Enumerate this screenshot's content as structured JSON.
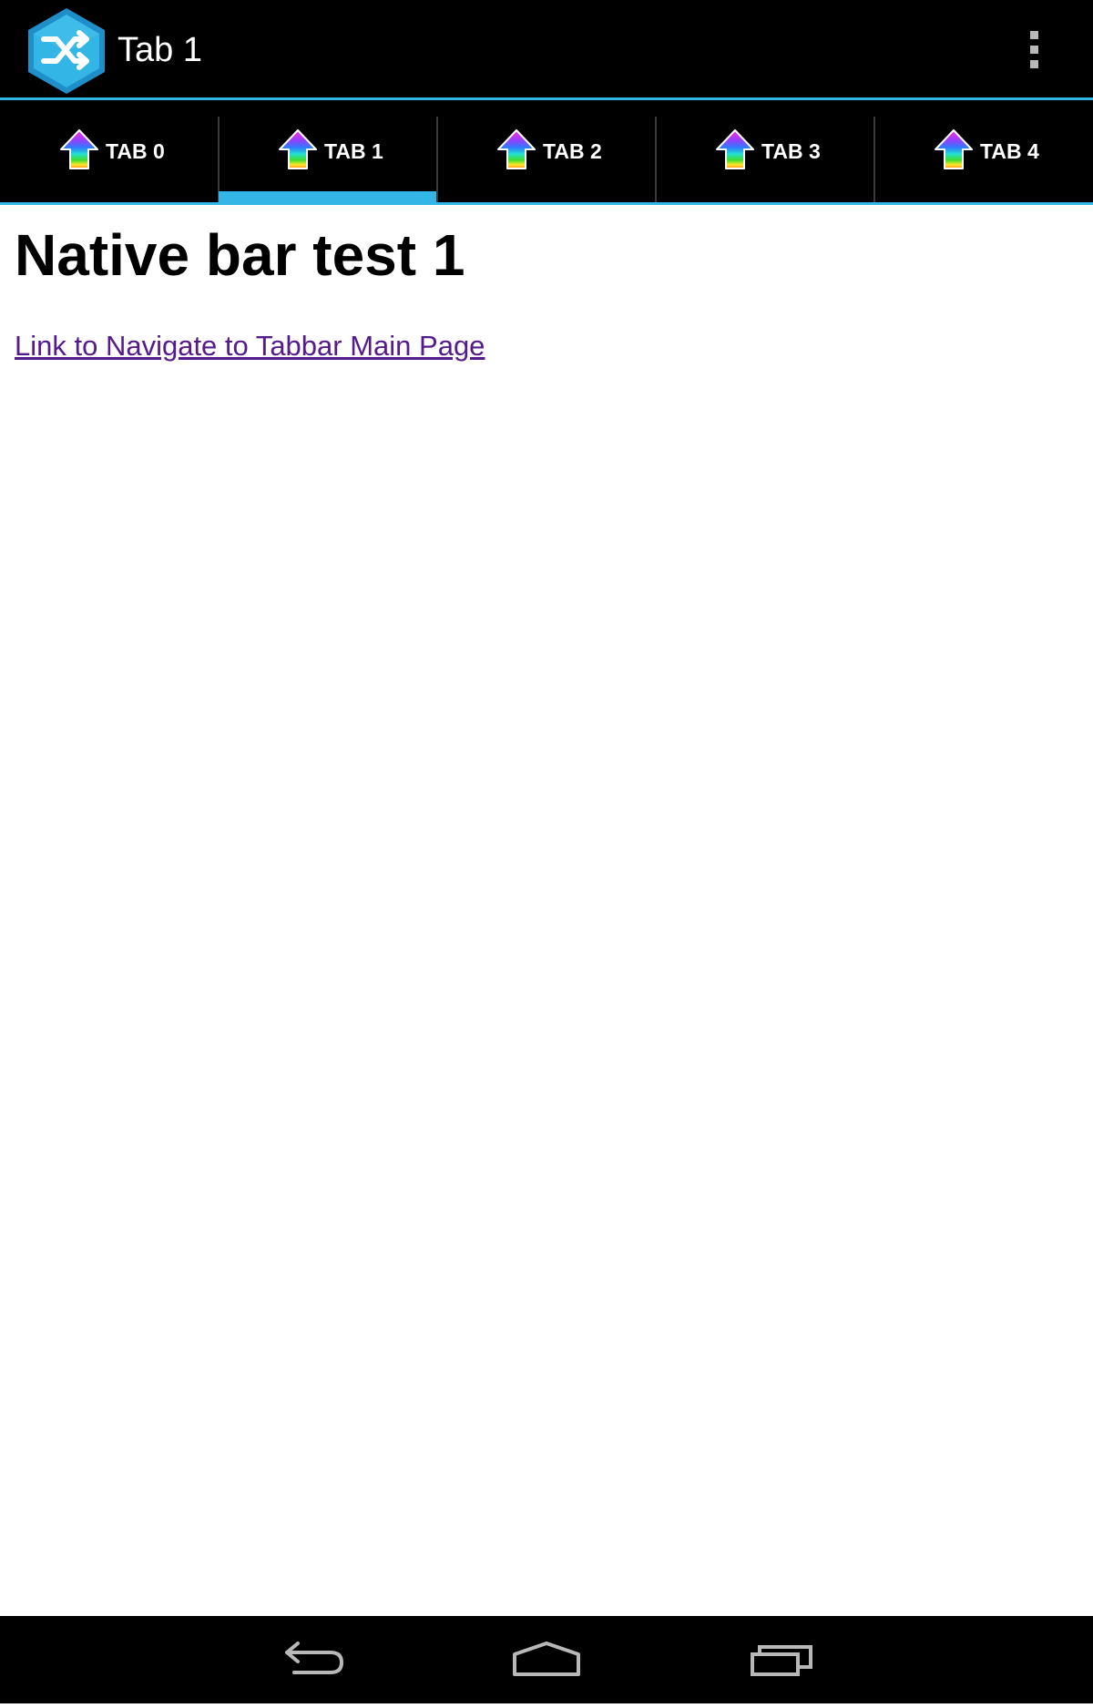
{
  "colors": {
    "bar_background": "#000000",
    "accent": "#33b5e5",
    "page_background": "#ffffff",
    "link_visited": "#551a8b"
  },
  "action_bar": {
    "title": "Tab 1",
    "app_icon": "shuffle-hexagon-icon",
    "overflow_icon": "overflow-menu-icon"
  },
  "tabs": [
    {
      "label": "TAB 0",
      "icon": "rainbow-up-arrow-icon",
      "selected": false
    },
    {
      "label": "TAB 1",
      "icon": "rainbow-up-arrow-icon",
      "selected": true
    },
    {
      "label": "TAB 2",
      "icon": "rainbow-up-arrow-icon",
      "selected": false
    },
    {
      "label": "TAB 3",
      "icon": "rainbow-up-arrow-icon",
      "selected": false
    },
    {
      "label": "TAB 4",
      "icon": "rainbow-up-arrow-icon",
      "selected": false
    }
  ],
  "content": {
    "heading": "Native bar test 1",
    "link_text": "Link to Navigate to Tabbar Main Page"
  },
  "system_nav": {
    "back_icon": "back-icon",
    "home_icon": "home-icon",
    "recents_icon": "recent-apps-icon"
  }
}
